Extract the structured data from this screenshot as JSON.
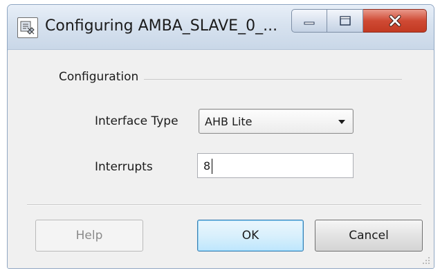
{
  "window": {
    "title": "Configuring AMBA_SLAVE_0_...",
    "app_icon": "component-config-icon",
    "caption_buttons": [
      "minimize-icon",
      "maximize-icon",
      "close-icon"
    ],
    "close_color": "#c23a22"
  },
  "group": {
    "label": "Configuration"
  },
  "fields": {
    "interface_type": {
      "label": "Interface Type",
      "value": "AHB Lite"
    },
    "interrupts": {
      "label": "Interrupts",
      "value": "8"
    }
  },
  "buttons": {
    "help": "Help",
    "ok": "OK",
    "cancel": "Cancel",
    "default_accent": "#3c7fb1"
  }
}
